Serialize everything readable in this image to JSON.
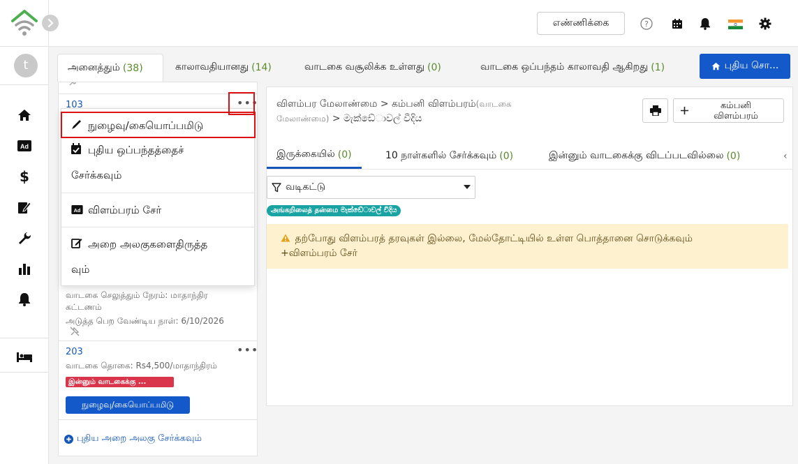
{
  "top": {
    "count_label": "எண்ணிக்கை"
  },
  "tabs": [
    {
      "label": "அனைத்தும்",
      "count": "(38)"
    },
    {
      "label": "காலாவதியானது",
      "count": "(14)"
    },
    {
      "label": "வாடகை வசூலிக்க உள்ளது",
      "count": "(0)"
    },
    {
      "label": "வாடகை ஒப்பந்தம் காலாவதி ஆகிறது",
      "count": "(1)"
    }
  ],
  "new_button": "புதிய சொ...",
  "room103": {
    "number": "103",
    "rent_time": "வாடகை செலுத்தும் நேரம்: மாதாந்திர",
    "rent_time2": "கட்டணம்",
    "next_due": "அடுத்த பெற வேண்டிய நாள்:  6/10/2026"
  },
  "room203": {
    "number": "203",
    "rent": "வாடகை தொகை: Rs4,500/மாதாந்திரம்",
    "badge": "இன்னும் வாடகைக்கு ...",
    "checkin": "நுழைவு/கையொப்பமிடு"
  },
  "add_room": "புதிய அறை அலகு சேர்க்கவும்",
  "dropdown": {
    "item1": "நுழைவு/கையொப்பமிடு",
    "item2a": "புதிய ஒப்பந்தத்தைச்",
    "item2b": "சேர்க்கவும்",
    "item3": "விளம்பரம் சேர்",
    "item4a": "அறை அலகுகளைதிருத்த",
    "item4b": "வும்"
  },
  "panel": {
    "crumb1": "விளம்பர மேலாண்மை",
    "crumb_sep": ">",
    "crumb2": "கம்பனி விளம்பரம்",
    "crumb2_note": "(வாடகை",
    "crumb3_note": "மேலாண்மை)",
    "crumb3": "මැක්ඩේ◌ාවල් වීදිය",
    "company_btn_line1": "கம்பனி",
    "company_btn_line2": "விளம்பரம்",
    "subtabs": [
      {
        "label": "இருக்கையில்",
        "count": "(0)"
      },
      {
        "label": "10 நாள்களில் சேர்க்கவும்",
        "count": "(0)"
      },
      {
        "label": "இன்னும் வாடகைக்கு விடப்படவில்லை",
        "count": "(0)"
      }
    ],
    "filter_label": "வடிகட்டு",
    "teal_badge": "அங்கறிலைத் தன்மை මැක්ඩේ◌ාවල් වීදිය",
    "alert_line1": "தற்போது விளம்பரத் தரவுகள் இல்லை, மேல்தோட்டியில் உள்ள பொத்தானை சொடுக்கவும்",
    "alert_line2": "+விளம்பரம் சேர்"
  },
  "colors": {
    "primary": "#1359c9",
    "link": "#1557b8",
    "count_green": "#5a8a2a",
    "danger": "#d9364b",
    "teal": "#1aa3a3",
    "alert_bg": "#fdf1cf",
    "logo_green": "#4caf50"
  },
  "icons": [
    "wifi-home-logo-icon",
    "chevron-right-icon",
    "home-icon",
    "ad-icon",
    "dollar-icon",
    "edit-document-icon",
    "wrench-icon",
    "bar-chart-icon",
    "bell-icon",
    "bed-icon",
    "help-icon",
    "calendar-icon",
    "india-flag-icon",
    "gear-icon",
    "pen-icon",
    "calendar-check-icon",
    "edit-icon",
    "print-icon",
    "plus-icon",
    "filter-icon",
    "warning-icon",
    "plus-circle-icon"
  ]
}
